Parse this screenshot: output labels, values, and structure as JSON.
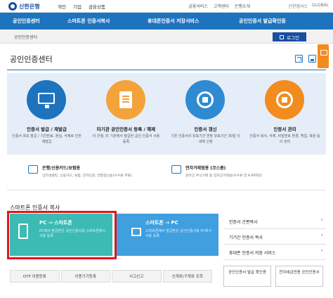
{
  "header": {
    "logo_text": "신한은행",
    "nav": [
      "개인",
      "기업",
      "금융상품"
    ],
    "util_links": [
      "금융서비스",
      "고객센터",
      "은행소개"
    ],
    "user_info": [
      "신한앱서스",
      "GLOBAL"
    ]
  },
  "menu": {
    "items": [
      "공인인증센터",
      "스마트폰 인증서복사",
      "휴대폰인증서 저장서비스",
      "공인인증서 발급확인증"
    ]
  },
  "breadcrumb": {
    "text": "공인인증센터"
  },
  "login_button": {
    "label": "로그인"
  },
  "page_title": "공인인증센터",
  "features": [
    {
      "title": "인증서 발급 / 재발급",
      "desc": "인증서 최초 발급 / 기간만료, 분실, 삭제로 인한 재발급"
    },
    {
      "title": "타기관 공인인증서 등록 / 해제",
      "desc": "타 은행, 타 기관에서 발급한 공인 인증서 사용 등록"
    },
    {
      "title": "인증서 갱신",
      "desc": "기존 인증서의 유효기간 연장 유효기간 30일 이내에 신청"
    },
    {
      "title": "인증서 관리",
      "desc": "인증서 복사, 삭제, 비밀번호 변경, 백업, 복원 등의 관리"
    }
  ],
  "info_rows": [
    {
      "label": "은행/신용카드/보험용",
      "desc": "인터넷뱅킹, 신용카드, 보험, 전자민원, 연말정산용(수수료 무료)"
    },
    {
      "label": "전자거래범용 (코스콤)",
      "desc": "온라인 주식거래 등 전자상거래용(수수료 연 4,400원)"
    }
  ],
  "smartphone_section": {
    "title": "스마트폰 인증서 복사",
    "cards": [
      {
        "title": "PC → 스마트폰",
        "desc": "PC에서 발급받은 공인인증서를 스마트폰에서 사용 등록"
      },
      {
        "title": "스마트폰 → PC",
        "desc": "스마트폰에서 발급받은 공인인증서를 PC에서 사용 등록"
      }
    ],
    "side_links": [
      "인증서 간편복사",
      "기기간 인증서 복사",
      "휴대폰 인증서 저장 서비스"
    ]
  },
  "bottom_buttons": [
    "OTP 이용등록",
    "이용기기등록",
    "사고신고",
    "신계좌/구계좌 조회"
  ],
  "box_buttons": [
    "공인인증서 발급 확인증",
    "전자세금전용 공인인증서"
  ],
  "colors": {
    "primary_blue": "#1e73be",
    "dark_blue": "#1a4ea1",
    "orange": "#f28c1e",
    "teal": "#3bbbb3",
    "highlight_red": "#e0171b"
  }
}
